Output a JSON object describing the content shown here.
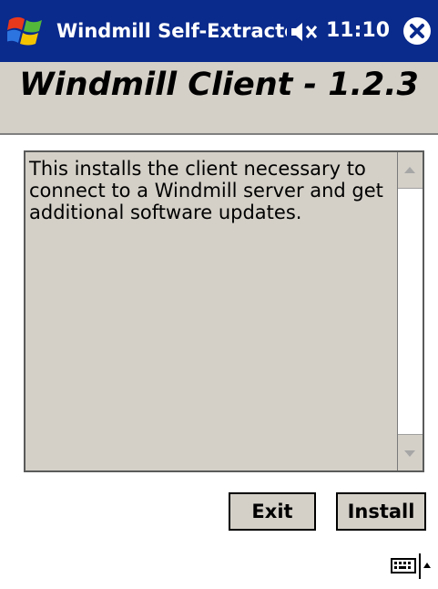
{
  "window": {
    "title": "Windmill Self-Extracto",
    "time": "11:10",
    "icons": {
      "start": "windows-flag-icon",
      "volume": "speaker-muted-icon",
      "close": "close-icon",
      "keyboard": "keyboard-icon",
      "sip_arrow": "chevron-up-icon"
    }
  },
  "header": {
    "title": "Windmill Client - 1.2.3"
  },
  "body": {
    "description": "This installs the client necessary to connect to a Windmill server and get additional software updates."
  },
  "buttons": {
    "exit_label": "Exit",
    "install_label": "Install"
  },
  "colors": {
    "titlebar": "#0a2a8c",
    "dialog_gray": "#d4d0c8"
  }
}
